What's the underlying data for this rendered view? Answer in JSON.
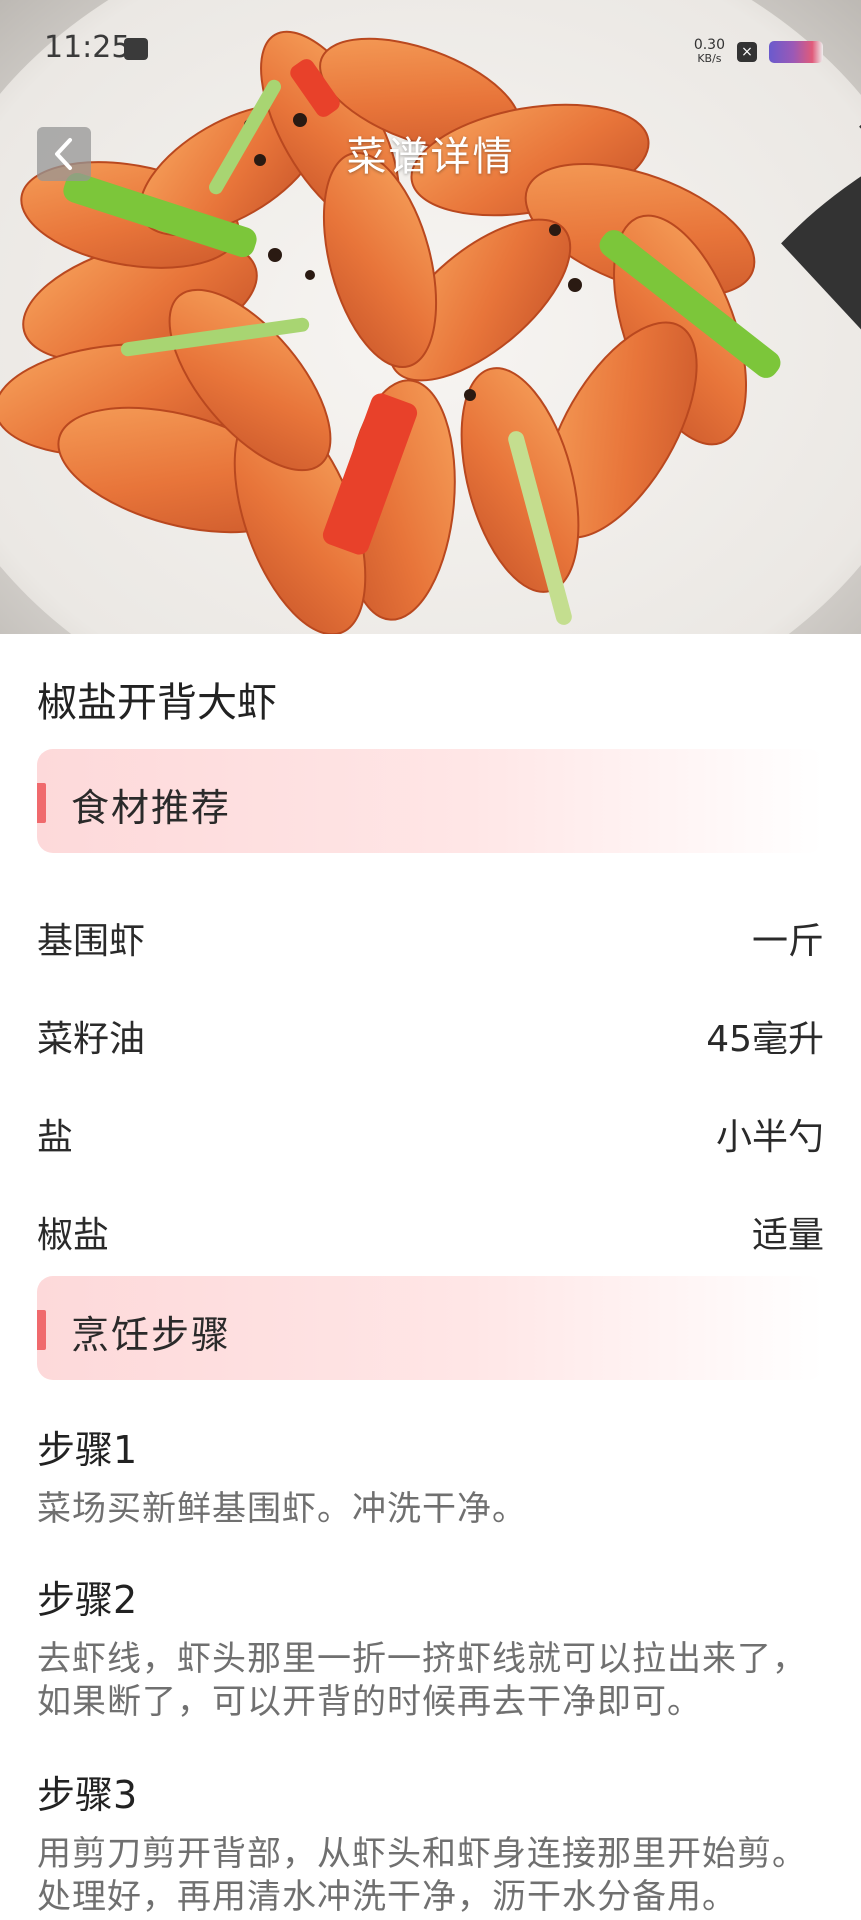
{
  "status_bar": {
    "time": "11:25",
    "speed_value": "0.30",
    "speed_unit": "KB/s",
    "icons": [
      "message-icon",
      "mute-icon",
      "close-icon",
      "wifi-icon",
      "battery-icon"
    ]
  },
  "header": {
    "title": "菜谱详情",
    "back_icon": "chevron-left-icon"
  },
  "recipe": {
    "name": "椒盐开背大虾"
  },
  "ingredients_section": {
    "title": "食材推荐",
    "items": [
      {
        "name": "基围虾",
        "qty": "一斤"
      },
      {
        "name": "菜籽油",
        "qty": "45毫升"
      },
      {
        "name": "盐",
        "qty": "小半勺"
      },
      {
        "name": "椒盐",
        "qty": "适量"
      }
    ]
  },
  "steps_section": {
    "title": "烹饪步骤",
    "steps": [
      {
        "title": "步骤1",
        "text": "菜场买新鲜基围虾。冲洗干净。"
      },
      {
        "title": "步骤2",
        "text": "去虾线，虾头那里一折一挤虾线就可以拉出来了，如果断了，可以开背的时候再去干净即可。"
      },
      {
        "title": "步骤3",
        "text": "用剪刀剪开背部，从虾头和虾身连接那里开始剪。处理好，再用清水冲洗干净，沥干水分备用。"
      }
    ]
  },
  "colors": {
    "accent": "#f06a6d",
    "section_bg": "#fdd9da",
    "step_text": "#707070"
  }
}
